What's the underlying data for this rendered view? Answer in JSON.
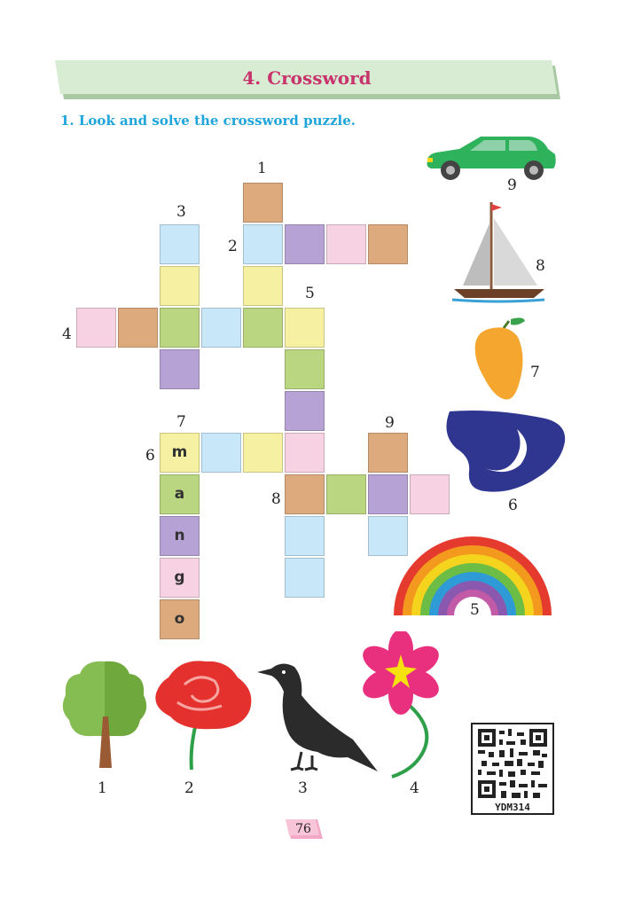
{
  "header": {
    "title": "4. Crossword"
  },
  "instruction": "1. Look and solve the crossword puzzle.",
  "colors": {
    "blue": "#c8e8fa",
    "purple": "#b7a2d6",
    "pink": "#f7d2e2",
    "tan": "#dcaa7d",
    "yellow": "#f5f0a2",
    "green": "#bbd680",
    "title": "#c8336b",
    "instruction": "#1fa5dc"
  },
  "grid": {
    "clue_numbers": [
      "1",
      "2",
      "3",
      "4",
      "5",
      "6",
      "7",
      "8",
      "9"
    ],
    "filled_answer": {
      "clue": "7",
      "letters": [
        "m",
        "a",
        "n",
        "g",
        "o"
      ]
    }
  },
  "clue_pictures": [
    {
      "number": "9",
      "icon": "car-icon"
    },
    {
      "number": "8",
      "icon": "sailboat-icon"
    },
    {
      "number": "7",
      "icon": "mango-icon"
    },
    {
      "number": "6",
      "icon": "moon-icon"
    },
    {
      "number": "5",
      "icon": "rainbow-icon"
    },
    {
      "number": "1",
      "icon": "tree-icon"
    },
    {
      "number": "2",
      "icon": "rose-icon"
    },
    {
      "number": "3",
      "icon": "crow-icon"
    },
    {
      "number": "4",
      "icon": "flower-icon"
    }
  ],
  "qr": {
    "code": "YDM314"
  },
  "page_number": "76"
}
